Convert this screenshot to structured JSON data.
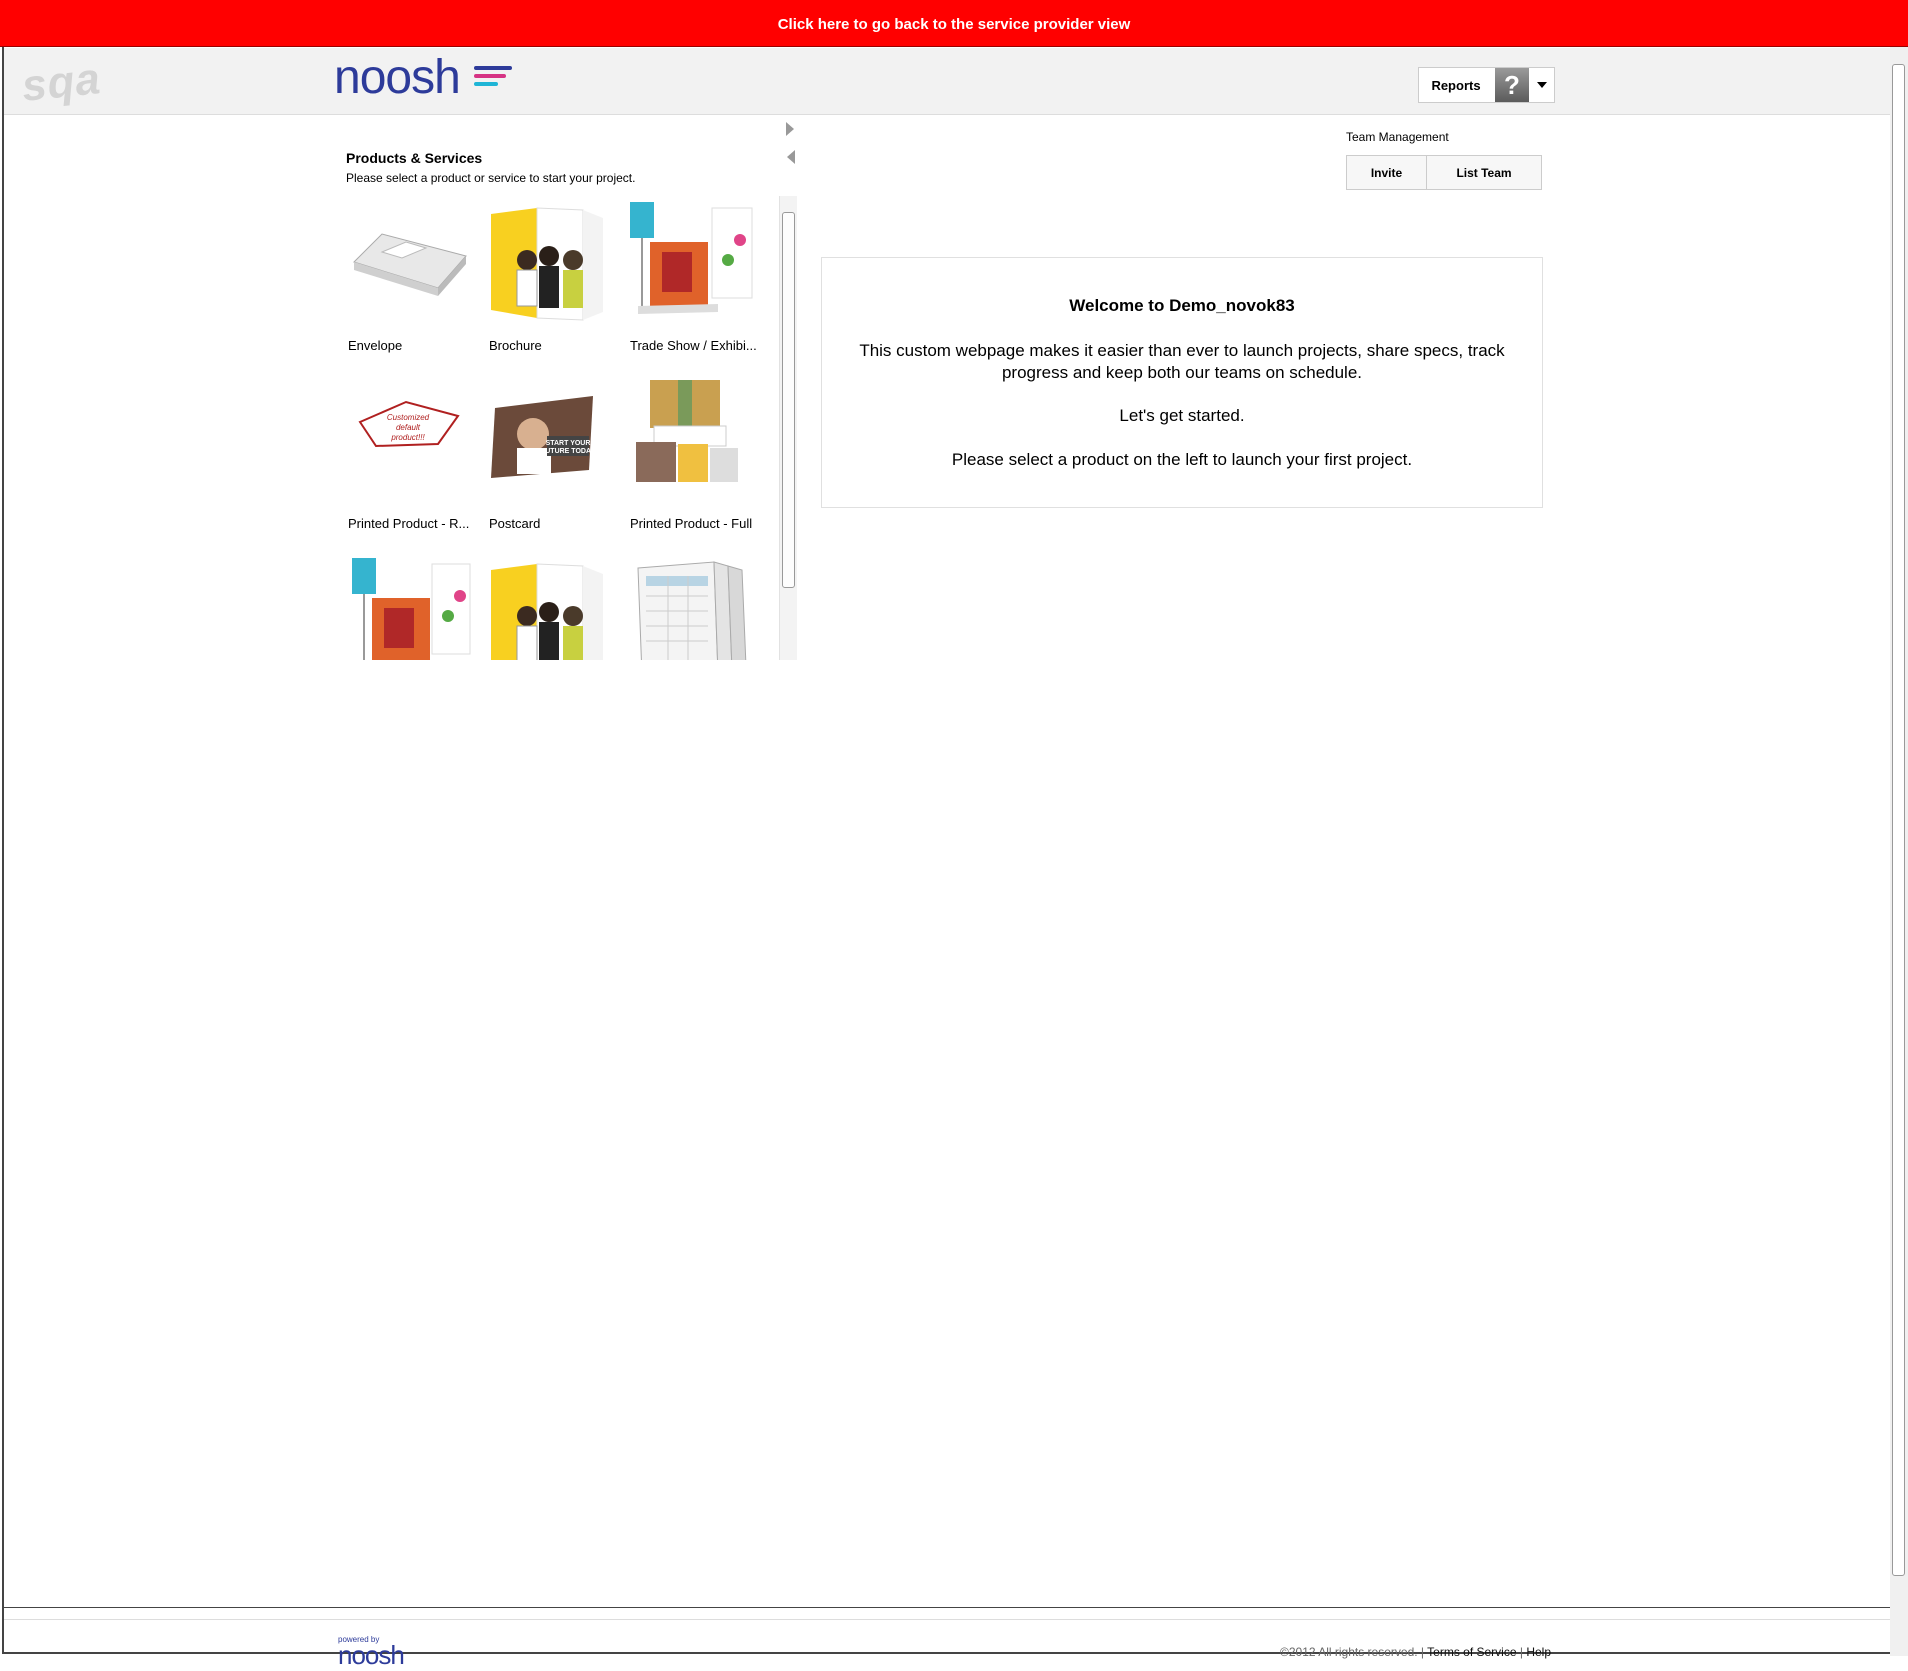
{
  "banner": {
    "text": "Click here to go back to the service provider view"
  },
  "header": {
    "env_label": "sqa",
    "logo_text": "noosh",
    "reports_label": "Reports",
    "avatar_glyph": "?",
    "colors": {
      "banner": "#ff0000",
      "logo": "#2d3b9a"
    }
  },
  "products": {
    "title": "Products & Services",
    "subtitle": "Please select a product or service to start your project.",
    "items": [
      {
        "label": "Envelope",
        "thumb": "envelope-image"
      },
      {
        "label": "Brochure",
        "thumb": "brochure-image"
      },
      {
        "label": "Trade Show / Exhibi...",
        "thumb": "trade-show-image"
      },
      {
        "label": "Printed Product - R...",
        "thumb": "custom-product-image",
        "thumb_text": "Customized default product!!!"
      },
      {
        "label": "Postcard",
        "thumb": "postcard-image",
        "thumb_text": "START YOUR FUTURE TODAY"
      },
      {
        "label": "Printed Product - Full",
        "thumb": "printed-product-image"
      },
      {
        "label": "",
        "thumb": "trade-show-image"
      },
      {
        "label": "",
        "thumb": "brochure-image"
      },
      {
        "label": "",
        "thumb": "forms-image"
      }
    ]
  },
  "team_management": {
    "title": "Team Management",
    "invite_label": "Invite",
    "list_team_label": "List Team"
  },
  "welcome": {
    "title": "Welcome to Demo_novok83",
    "p1": "This custom webpage makes it easier than ever to launch projects, share specs, track progress and keep both our teams on schedule.",
    "p2": "Let's get started.",
    "p3": "Please select a product on the left to launch your first project."
  },
  "footer": {
    "powered_by": "powered by",
    "logo_text": "noosh",
    "copyright": "©2012 All rights reserved. |",
    "terms": "Terms of Service",
    "separator": "|",
    "help": "Help"
  }
}
